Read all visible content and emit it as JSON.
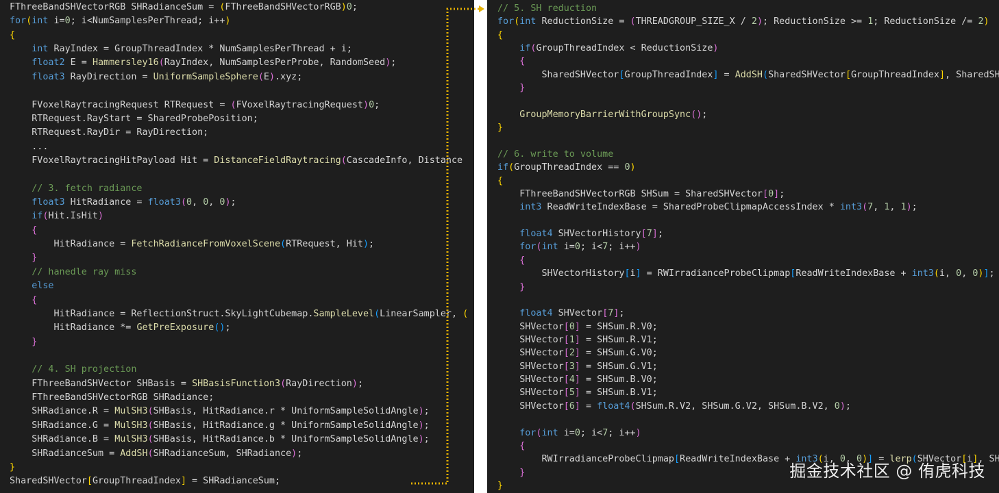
{
  "theme": {
    "background": "#1e1e1e",
    "keyword": "#569cd6",
    "type": "#d4d4d4",
    "comment": "#6a9955",
    "function": "#dcdcaa",
    "number": "#b5cea8",
    "bracket_levels": [
      "#ffd700",
      "#da70d6",
      "#179fff"
    ],
    "connector": "#e5b000"
  },
  "left_pane": {
    "lines": [
      [
        [
          "t",
          "FThreeBandSHVectorRGB SHRadianceSum = "
        ],
        [
          "b0",
          "("
        ],
        [
          "t",
          "FThreeBandSHVectorRGB"
        ],
        [
          "b0",
          ")"
        ],
        [
          "n",
          "0"
        ],
        [
          "p",
          ";"
        ]
      ],
      [
        [
          "k",
          "for"
        ],
        [
          "b0",
          "("
        ],
        [
          "k",
          "int"
        ],
        [
          "p",
          " i="
        ],
        [
          "n",
          "0"
        ],
        [
          "p",
          "; i<NumSamplesPerThread; i++"
        ],
        [
          "b0",
          ")"
        ]
      ],
      [
        [
          "b0",
          "{"
        ]
      ],
      [
        [
          "p",
          "    "
        ],
        [
          "k",
          "int"
        ],
        [
          "p",
          " RayIndex = GroupThreadIndex * NumSamplesPerThread + i;"
        ]
      ],
      [
        [
          "p",
          "    "
        ],
        [
          "k",
          "float2"
        ],
        [
          "p",
          " E = "
        ],
        [
          "f",
          "Hammersley16"
        ],
        [
          "b1",
          "("
        ],
        [
          "p",
          "RayIndex, NumSamplesPerProbe, RandomSeed"
        ],
        [
          "b1",
          ")"
        ],
        [
          "p",
          ";"
        ]
      ],
      [
        [
          "p",
          "    "
        ],
        [
          "k",
          "float3"
        ],
        [
          "p",
          " RayDirection = "
        ],
        [
          "f",
          "UniformSampleSphere"
        ],
        [
          "b1",
          "("
        ],
        [
          "p",
          "E"
        ],
        [
          "b1",
          ")"
        ],
        [
          "p",
          ".xyz;"
        ]
      ],
      [],
      [
        [
          "p",
          "    "
        ],
        [
          "t",
          "FVoxelRaytracingRequest"
        ],
        [
          "p",
          " RTRequest = "
        ],
        [
          "b1",
          "("
        ],
        [
          "t",
          "FVoxelRaytracingRequest"
        ],
        [
          "b1",
          ")"
        ],
        [
          "n",
          "0"
        ],
        [
          "p",
          ";"
        ]
      ],
      [
        [
          "p",
          "    RTRequest.RayStart = SharedProbePosition;"
        ]
      ],
      [
        [
          "p",
          "    RTRequest.RayDir = RayDirection;"
        ]
      ],
      [
        [
          "p",
          "    ..."
        ]
      ],
      [
        [
          "p",
          "    "
        ],
        [
          "t",
          "FVoxelRaytracingHitPayload"
        ],
        [
          "p",
          " Hit = "
        ],
        [
          "f",
          "DistanceFieldRaytracing"
        ],
        [
          "b1",
          "("
        ],
        [
          "p",
          "CascadeInfo, Distance"
        ]
      ],
      [],
      [
        [
          "p",
          "    "
        ],
        [
          "c",
          "// 3. fetch radiance"
        ]
      ],
      [
        [
          "p",
          "    "
        ],
        [
          "k",
          "float3"
        ],
        [
          "p",
          " HitRadiance = "
        ],
        [
          "k",
          "float3"
        ],
        [
          "b1",
          "("
        ],
        [
          "n",
          "0"
        ],
        [
          "p",
          ", "
        ],
        [
          "n",
          "0"
        ],
        [
          "p",
          ", "
        ],
        [
          "n",
          "0"
        ],
        [
          "b1",
          ")"
        ],
        [
          "p",
          ";"
        ]
      ],
      [
        [
          "p",
          "    "
        ],
        [
          "k",
          "if"
        ],
        [
          "b1",
          "("
        ],
        [
          "p",
          "Hit.IsHit"
        ],
        [
          "b1",
          ")"
        ]
      ],
      [
        [
          "p",
          "    "
        ],
        [
          "b1",
          "{"
        ]
      ],
      [
        [
          "p",
          "        HitRadiance = "
        ],
        [
          "f",
          "FetchRadianceFromVoxelScene"
        ],
        [
          "b2",
          "("
        ],
        [
          "p",
          "RTRequest, Hit"
        ],
        [
          "b2",
          ")"
        ],
        [
          "p",
          ";"
        ]
      ],
      [
        [
          "p",
          "    "
        ],
        [
          "b1",
          "}"
        ]
      ],
      [
        [
          "p",
          "    "
        ],
        [
          "c",
          "// hanedle ray miss"
        ]
      ],
      [
        [
          "p",
          "    "
        ],
        [
          "k",
          "else"
        ]
      ],
      [
        [
          "p",
          "    "
        ],
        [
          "b1",
          "{"
        ]
      ],
      [
        [
          "p",
          "        HitRadiance = ReflectionStruct.SkyLightCubemap."
        ],
        [
          "f",
          "SampleLevel"
        ],
        [
          "b2",
          "("
        ],
        [
          "p",
          "LinearSampler, "
        ],
        [
          "b0",
          "("
        ]
      ],
      [
        [
          "p",
          "        HitRadiance *= "
        ],
        [
          "f",
          "GetPreExposure"
        ],
        [
          "b2",
          "()"
        ],
        [
          "p",
          ";"
        ]
      ],
      [
        [
          "p",
          "    "
        ],
        [
          "b1",
          "}"
        ]
      ],
      [],
      [
        [
          "p",
          "    "
        ],
        [
          "c",
          "// 4. SH projection"
        ]
      ],
      [
        [
          "p",
          "    "
        ],
        [
          "t",
          "FThreeBandSHVector"
        ],
        [
          "p",
          " SHBasis = "
        ],
        [
          "f",
          "SHBasisFunction3"
        ],
        [
          "b1",
          "("
        ],
        [
          "p",
          "RayDirection"
        ],
        [
          "b1",
          ")"
        ],
        [
          "p",
          ";"
        ]
      ],
      [
        [
          "p",
          "    "
        ],
        [
          "t",
          "FThreeBandSHVectorRGB"
        ],
        [
          "p",
          " SHRadiance;"
        ]
      ],
      [
        [
          "p",
          "    SHRadiance.R = "
        ],
        [
          "f",
          "MulSH3"
        ],
        [
          "b1",
          "("
        ],
        [
          "p",
          "SHBasis, HitRadiance.r * UniformSampleSolidAngle"
        ],
        [
          "b1",
          ")"
        ],
        [
          "p",
          ";"
        ]
      ],
      [
        [
          "p",
          "    SHRadiance.G = "
        ],
        [
          "f",
          "MulSH3"
        ],
        [
          "b1",
          "("
        ],
        [
          "p",
          "SHBasis, HitRadiance.g * UniformSampleSolidAngle"
        ],
        [
          "b1",
          ")"
        ],
        [
          "p",
          ";"
        ]
      ],
      [
        [
          "p",
          "    SHRadiance.B = "
        ],
        [
          "f",
          "MulSH3"
        ],
        [
          "b1",
          "("
        ],
        [
          "p",
          "SHBasis, HitRadiance.b * UniformSampleSolidAngle"
        ],
        [
          "b1",
          ")"
        ],
        [
          "p",
          ";"
        ]
      ],
      [
        [
          "p",
          "    SHRadianceSum = "
        ],
        [
          "f",
          "AddSH"
        ],
        [
          "b1",
          "("
        ],
        [
          "p",
          "SHRadianceSum, SHRadiance"
        ],
        [
          "b1",
          ")"
        ],
        [
          "p",
          ";"
        ]
      ],
      [
        [
          "b0",
          "}"
        ]
      ],
      [
        [
          "p",
          "SharedSHVector"
        ],
        [
          "b0",
          "["
        ],
        [
          "p",
          "GroupThreadIndex"
        ],
        [
          "b0",
          "]"
        ],
        [
          "p",
          " = SHRadianceSum;"
        ]
      ]
    ]
  },
  "right_pane": {
    "lines": [
      [
        [
          "c",
          "// 5. SH reduction"
        ]
      ],
      [
        [
          "k",
          "for"
        ],
        [
          "b0",
          "("
        ],
        [
          "k",
          "int"
        ],
        [
          "p",
          " ReductionSize = "
        ],
        [
          "b1",
          "("
        ],
        [
          "p",
          "THREADGROUP_SIZE_X / "
        ],
        [
          "n",
          "2"
        ],
        [
          "b1",
          ")"
        ],
        [
          "p",
          "; ReductionSize >= "
        ],
        [
          "n",
          "1"
        ],
        [
          "p",
          "; ReductionSize /= "
        ],
        [
          "n",
          "2"
        ],
        [
          "b0",
          ")"
        ]
      ],
      [
        [
          "b0",
          "{"
        ]
      ],
      [
        [
          "p",
          "    "
        ],
        [
          "k",
          "if"
        ],
        [
          "b1",
          "("
        ],
        [
          "p",
          "GroupThreadIndex < ReductionSize"
        ],
        [
          "b1",
          ")"
        ]
      ],
      [
        [
          "p",
          "    "
        ],
        [
          "b1",
          "{"
        ]
      ],
      [
        [
          "p",
          "        SharedSHVector"
        ],
        [
          "b2",
          "["
        ],
        [
          "p",
          "GroupThreadIndex"
        ],
        [
          "b2",
          "]"
        ],
        [
          "p",
          " = "
        ],
        [
          "f",
          "AddSH"
        ],
        [
          "b2",
          "("
        ],
        [
          "p",
          "SharedSHVector"
        ],
        [
          "b0",
          "["
        ],
        [
          "p",
          "GroupThreadIndex"
        ],
        [
          "b0",
          "]"
        ],
        [
          "p",
          ", SharedSHVec"
        ]
      ],
      [
        [
          "p",
          "    "
        ],
        [
          "b1",
          "}"
        ]
      ],
      [],
      [
        [
          "p",
          "    "
        ],
        [
          "f",
          "GroupMemoryBarrierWithGroupSync"
        ],
        [
          "b1",
          "()"
        ],
        [
          "p",
          ";"
        ]
      ],
      [
        [
          "b0",
          "}"
        ]
      ],
      [],
      [
        [
          "c",
          "// 6. write to volume"
        ]
      ],
      [
        [
          "k",
          "if"
        ],
        [
          "b0",
          "("
        ],
        [
          "p",
          "GroupThreadIndex == "
        ],
        [
          "n",
          "0"
        ],
        [
          "b0",
          ")"
        ]
      ],
      [
        [
          "b0",
          "{"
        ]
      ],
      [
        [
          "p",
          "    "
        ],
        [
          "t",
          "FThreeBandSHVectorRGB"
        ],
        [
          "p",
          " SHSum = SharedSHVector"
        ],
        [
          "b1",
          "["
        ],
        [
          "n",
          "0"
        ],
        [
          "b1",
          "]"
        ],
        [
          "p",
          ";"
        ]
      ],
      [
        [
          "p",
          "    "
        ],
        [
          "k",
          "int3"
        ],
        [
          "p",
          " ReadWriteIndexBase = SharedProbeClipmapAccessIndex * "
        ],
        [
          "k",
          "int3"
        ],
        [
          "b1",
          "("
        ],
        [
          "n",
          "7"
        ],
        [
          "p",
          ", "
        ],
        [
          "n",
          "1"
        ],
        [
          "p",
          ", "
        ],
        [
          "n",
          "1"
        ],
        [
          "b1",
          ")"
        ],
        [
          "p",
          ";"
        ]
      ],
      [],
      [
        [
          "p",
          "    "
        ],
        [
          "k",
          "float4"
        ],
        [
          "p",
          " SHVectorHistory"
        ],
        [
          "b1",
          "["
        ],
        [
          "n",
          "7"
        ],
        [
          "b1",
          "]"
        ],
        [
          "p",
          ";"
        ]
      ],
      [
        [
          "p",
          "    "
        ],
        [
          "k",
          "for"
        ],
        [
          "b1",
          "("
        ],
        [
          "k",
          "int"
        ],
        [
          "p",
          " i="
        ],
        [
          "n",
          "0"
        ],
        [
          "p",
          "; i<"
        ],
        [
          "n",
          "7"
        ],
        [
          "p",
          "; i++"
        ],
        [
          "b1",
          ")"
        ]
      ],
      [
        [
          "p",
          "    "
        ],
        [
          "b1",
          "{"
        ]
      ],
      [
        [
          "p",
          "        SHVectorHistory"
        ],
        [
          "b2",
          "["
        ],
        [
          "p",
          "i"
        ],
        [
          "b2",
          "]"
        ],
        [
          "p",
          " = RWIrradianceProbeClipmap"
        ],
        [
          "b2",
          "["
        ],
        [
          "p",
          "ReadWriteIndexBase + "
        ],
        [
          "k",
          "int3"
        ],
        [
          "b0",
          "("
        ],
        [
          "p",
          "i, "
        ],
        [
          "n",
          "0"
        ],
        [
          "p",
          ", "
        ],
        [
          "n",
          "0"
        ],
        [
          "b0",
          ")"
        ],
        [
          "b2",
          "]"
        ],
        [
          "p",
          ";"
        ]
      ],
      [
        [
          "p",
          "    "
        ],
        [
          "b1",
          "}"
        ]
      ],
      [],
      [
        [
          "p",
          "    "
        ],
        [
          "k",
          "float4"
        ],
        [
          "p",
          " SHVector"
        ],
        [
          "b1",
          "["
        ],
        [
          "n",
          "7"
        ],
        [
          "b1",
          "]"
        ],
        [
          "p",
          ";"
        ]
      ],
      [
        [
          "p",
          "    SHVector"
        ],
        [
          "b1",
          "["
        ],
        [
          "n",
          "0"
        ],
        [
          "b1",
          "]"
        ],
        [
          "p",
          " = SHSum.R.V0;"
        ]
      ],
      [
        [
          "p",
          "    SHVector"
        ],
        [
          "b1",
          "["
        ],
        [
          "n",
          "1"
        ],
        [
          "b1",
          "]"
        ],
        [
          "p",
          " = SHSum.R.V1;"
        ]
      ],
      [
        [
          "p",
          "    SHVector"
        ],
        [
          "b1",
          "["
        ],
        [
          "n",
          "2"
        ],
        [
          "b1",
          "]"
        ],
        [
          "p",
          " = SHSum.G.V0;"
        ]
      ],
      [
        [
          "p",
          "    SHVector"
        ],
        [
          "b1",
          "["
        ],
        [
          "n",
          "3"
        ],
        [
          "b1",
          "]"
        ],
        [
          "p",
          " = SHSum.G.V1;"
        ]
      ],
      [
        [
          "p",
          "    SHVector"
        ],
        [
          "b1",
          "["
        ],
        [
          "n",
          "4"
        ],
        [
          "b1",
          "]"
        ],
        [
          "p",
          " = SHSum.B.V0;"
        ]
      ],
      [
        [
          "p",
          "    SHVector"
        ],
        [
          "b1",
          "["
        ],
        [
          "n",
          "5"
        ],
        [
          "b1",
          "]"
        ],
        [
          "p",
          " = SHSum.B.V1;"
        ]
      ],
      [
        [
          "p",
          "    SHVector"
        ],
        [
          "b1",
          "["
        ],
        [
          "n",
          "6"
        ],
        [
          "b1",
          "]"
        ],
        [
          "p",
          " = "
        ],
        [
          "k",
          "float4"
        ],
        [
          "b1",
          "("
        ],
        [
          "p",
          "SHSum.R.V2, SHSum.G.V2, SHSum.B.V2, "
        ],
        [
          "n",
          "0"
        ],
        [
          "b1",
          ")"
        ],
        [
          "p",
          ";"
        ]
      ],
      [],
      [
        [
          "p",
          "    "
        ],
        [
          "k",
          "for"
        ],
        [
          "b1",
          "("
        ],
        [
          "k",
          "int"
        ],
        [
          "p",
          " i="
        ],
        [
          "n",
          "0"
        ],
        [
          "p",
          "; i<"
        ],
        [
          "n",
          "7"
        ],
        [
          "p",
          "; i++"
        ],
        [
          "b1",
          ")"
        ]
      ],
      [
        [
          "p",
          "    "
        ],
        [
          "b1",
          "{"
        ]
      ],
      [
        [
          "p",
          "        RWIrradianceProbeClipmap"
        ],
        [
          "b2",
          "["
        ],
        [
          "p",
          "ReadWriteIndexBase + "
        ],
        [
          "k",
          "int3"
        ],
        [
          "b0",
          "("
        ],
        [
          "p",
          "i, "
        ],
        [
          "n",
          "0"
        ],
        [
          "p",
          ", "
        ],
        [
          "n",
          "0"
        ],
        [
          "b0",
          ")"
        ],
        [
          "b2",
          "]"
        ],
        [
          "p",
          " = "
        ],
        [
          "f",
          "lerp"
        ],
        [
          "b2",
          "("
        ],
        [
          "p",
          "SHVector"
        ],
        [
          "b0",
          "["
        ],
        [
          "p",
          "i"
        ],
        [
          "b0",
          "]"
        ],
        [
          "p",
          ", SHVec"
        ]
      ],
      [
        [
          "p",
          "    "
        ],
        [
          "b1",
          "}"
        ]
      ],
      [
        [
          "b0",
          "}"
        ]
      ]
    ]
  },
  "watermark": "掘金技术社区 @ 侑虎科技"
}
